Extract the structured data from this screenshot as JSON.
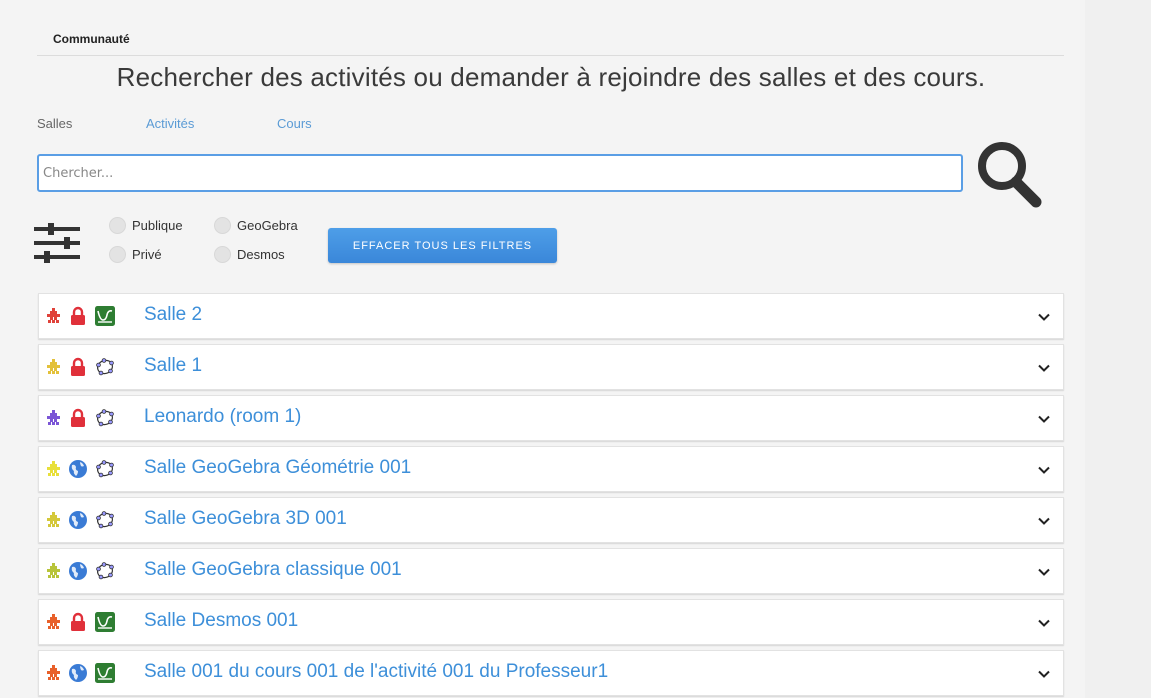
{
  "header": {
    "section_title": "Communauté",
    "headline": "Rechercher des activités ou demander à rejoindre des salles et des cours."
  },
  "tabs": [
    {
      "label": "Salles",
      "active": true
    },
    {
      "label": "Activités",
      "active": false
    },
    {
      "label": "Cours",
      "active": false
    }
  ],
  "search": {
    "placeholder": "Chercher...",
    "value": ""
  },
  "filters": {
    "privacy": [
      {
        "label": "Publique",
        "checked": false
      },
      {
        "label": "Privé",
        "checked": false
      }
    ],
    "tool": [
      {
        "label": "GeoGebra",
        "checked": false
      },
      {
        "label": "Desmos",
        "checked": false
      }
    ],
    "clear_label": "EFFACER TOUS LES FILTRES"
  },
  "rooms": [
    {
      "name": "Salle 2",
      "avatar_color": "#e0423a",
      "access": "lock-icon",
      "tool": "desmos-icon"
    },
    {
      "name": "Salle 1",
      "avatar_color": "#e3c13a",
      "access": "lock-icon",
      "tool": "geogebra-icon"
    },
    {
      "name": "Leonardo (room 1)",
      "avatar_color": "#7b55d6",
      "access": "lock-icon",
      "tool": "geogebra-icon"
    },
    {
      "name": "Salle GeoGebra Géométrie 001",
      "avatar_color": "#e8e03a",
      "access": "globe-icon",
      "tool": "geogebra-icon"
    },
    {
      "name": "Salle GeoGebra 3D 001",
      "avatar_color": "#d4c83a",
      "access": "globe-icon",
      "tool": "geogebra-icon"
    },
    {
      "name": "Salle GeoGebra classique 001",
      "avatar_color": "#b8c43a",
      "access": "globe-icon",
      "tool": "geogebra-icon"
    },
    {
      "name": "Salle Desmos 001",
      "avatar_color": "#e8602a",
      "access": "lock-icon",
      "tool": "desmos-icon"
    },
    {
      "name": "Salle 001 du cours 001 de l'activité 001 du Professeur1",
      "avatar_color": "#e8602a",
      "access": "globe-icon",
      "tool": "desmos-icon"
    }
  ],
  "colors": {
    "accent": "#3d8fd9",
    "lock": "#e0303a",
    "globe": "#3a7bd5",
    "desmos": "#2e7d32",
    "button": "#3a87d9"
  }
}
